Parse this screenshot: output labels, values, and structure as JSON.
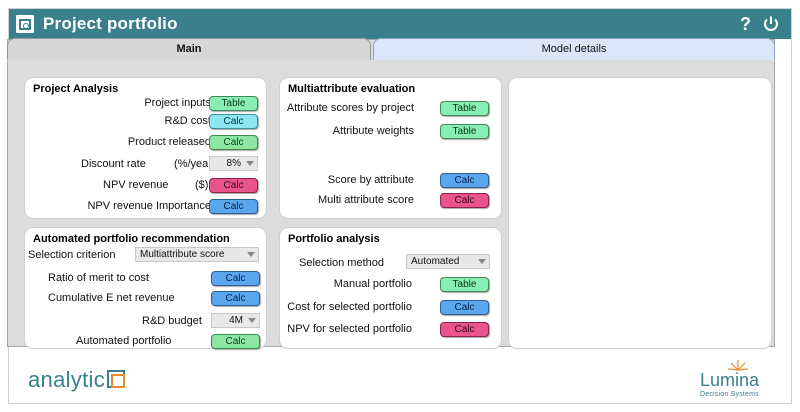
{
  "app": {
    "title": "Project portfolio",
    "help_label": "?"
  },
  "tabs": {
    "main": "Main",
    "model_details": "Model details"
  },
  "project_analysis": {
    "title": "Project Analysis",
    "rows": [
      {
        "label": "Project inputs",
        "button": "Table"
      },
      {
        "label": "R&D cost",
        "button": "Calc"
      },
      {
        "label": "Product released",
        "button": "Calc"
      },
      {
        "label": "Discount rate",
        "unit": "(%/year)",
        "select": "8%"
      },
      {
        "label": "NPV revenue",
        "unit": "($)",
        "button": "Calc"
      },
      {
        "label": "NPV revenue Importance",
        "button": "Calc"
      }
    ]
  },
  "multiattribute": {
    "title": "Multiattribute evaluation",
    "rows": [
      {
        "label": "Attribute scores by project",
        "button": "Table"
      },
      {
        "label": "Attribute weights",
        "button": "Table"
      },
      {
        "label": "Score by attribute",
        "button": "Calc"
      },
      {
        "label": "Multi attribute score",
        "button": "Calc"
      }
    ]
  },
  "automated": {
    "title": "Automated portfolio recommendation",
    "criterion_label": "Selection criterion",
    "criterion_value": "Multiattribute score",
    "rows": [
      {
        "label": "Ratio of merit to cost",
        "button": "Calc"
      },
      {
        "label": "Cumulative E net revenue",
        "button": "Calc"
      },
      {
        "label": "R&D budget",
        "select": "4M"
      },
      {
        "label": "Automated portfolio",
        "button": "Calc"
      }
    ]
  },
  "portfolio": {
    "title": "Portfolio analysis",
    "method_label": "Selection method",
    "method_value": "Automated",
    "rows": [
      {
        "label": "Manual portfolio",
        "button": "Table"
      },
      {
        "label": "Cost for selected portfolio",
        "button": "Calc"
      },
      {
        "label": "NPV for selected portfolio",
        "button": "Calc"
      }
    ]
  },
  "footer": {
    "logo_text": "analytic",
    "brand": "Lumina",
    "brand_sub": "Decision Systems"
  },
  "colors": {
    "titlebar": "#3a7f8c",
    "table": "#88eeb3",
    "calc_cyan": "#8ee6f2",
    "calc_green": "#8de7a3",
    "calc_blue": "#5ba7ee",
    "calc_pink": "#e8558c"
  }
}
